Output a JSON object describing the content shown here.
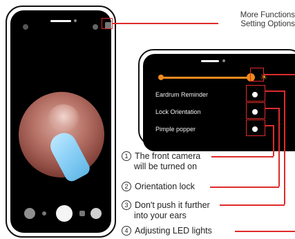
{
  "callouts": {
    "more_functions_line1": "More Functions",
    "more_functions_line2": "Setting Options"
  },
  "settings_panel": {
    "brightness_icon": "sun-icon",
    "rows": [
      {
        "label": "Eardrum Reminder"
      },
      {
        "label": "Lock Orientation"
      },
      {
        "label": "Pimple popper"
      }
    ]
  },
  "features": [
    {
      "num": "1",
      "line1": "The front camera",
      "line2": "will be turned on"
    },
    {
      "num": "2",
      "line1": "Orientation lock",
      "line2": ""
    },
    {
      "num": "3",
      "line1": "Don't push it further",
      "line2": "into your ears"
    },
    {
      "num": "4",
      "line1": "Adjusting LED lights",
      "line2": ""
    }
  ],
  "colors": {
    "accent_red": "#e02a2a",
    "slider_orange": "#f08a1c",
    "sun_yellow": "#f5a623"
  },
  "icons": {
    "toolbar": [
      "gallery-icon",
      "small-dot-icon",
      "shutter-icon",
      "menu-icon",
      "capture-icon"
    ],
    "top_right": "settings-icon"
  }
}
